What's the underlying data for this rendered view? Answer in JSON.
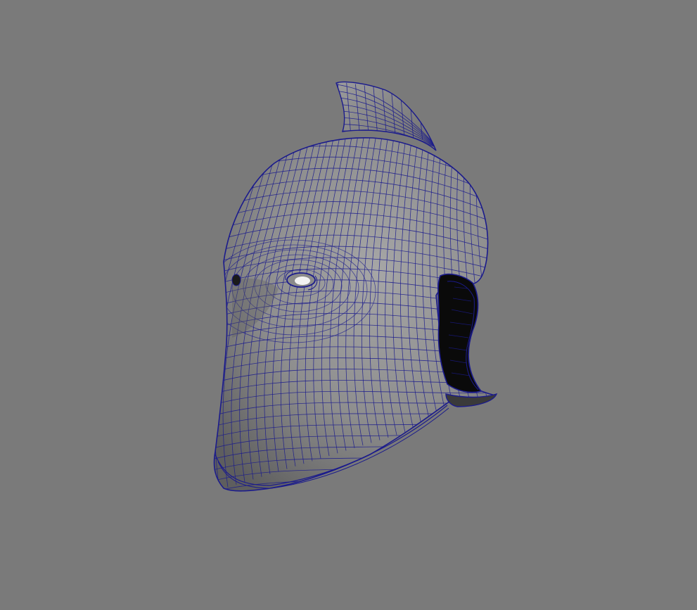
{
  "viewport": {
    "background_color": "#7a7a7a",
    "mesh_fill_light": "#a6a6a6",
    "mesh_fill_mid": "#8e8e8e",
    "mesh_fill_dark": "#5e5e5e",
    "wireframe_color": "#1b1b8c",
    "interior_color": "#0a0a0a"
  },
  "scene": {
    "object_icon": "wireframe-helmet-mesh",
    "display_mode": "wireframe-on-shaded"
  }
}
